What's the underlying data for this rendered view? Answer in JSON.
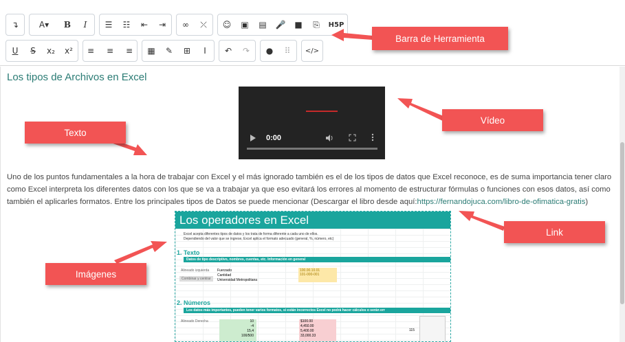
{
  "toolbar": {
    "row1": [
      [
        "paragraph-icon",
        "↴"
      ],
      [
        "font-color-icon",
        "A▾",
        "bold-icon",
        "B",
        "italic-icon",
        "I"
      ],
      [
        "bullet-list-icon",
        "☰",
        "numbered-list-icon",
        "☷",
        "outdent-icon",
        "⇤",
        "indent-icon",
        "⇥"
      ],
      [
        "link-icon",
        "∞",
        "unlink-icon",
        "⤫"
      ],
      [
        "emoji-icon",
        "☺",
        "image-icon",
        "▣",
        "media-icon",
        "▤",
        "record-audio-icon",
        "🎤",
        "record-video-icon",
        "■",
        "copy-icon",
        "⎘",
        "h5p-icon",
        "H5P"
      ]
    ],
    "row2": [
      [
        "underline-icon",
        "U",
        "strikethrough-icon",
        "S",
        "subscript-icon",
        "x₂",
        "superscript-icon",
        "x²"
      ],
      [
        "align-left-icon",
        "≡",
        "align-center-icon",
        "≡",
        "align-right-icon",
        "≡"
      ],
      [
        "calculator-icon",
        "▦",
        "edit-icon",
        "✎",
        "table-icon",
        "⊞",
        "clear-format-icon",
        "Ⅰ"
      ],
      [
        "undo-icon",
        "↶",
        "redo-icon",
        "↷"
      ],
      [
        "accessibility-icon",
        "●",
        "screenreader-icon",
        "⠿"
      ],
      [
        "html-icon",
        "</>"
      ]
    ]
  },
  "editor": {
    "title": "Los tipos de Archivos en Excel",
    "video_time": "0:00",
    "paragraph": "Uno de los puntos fundamentales a la hora de trabajar con Excel y el más ignorado también es el de los tipos de datos que Excel reconoce, es de suma importancia tener claro como Excel interpreta los diferentes datos con los que se va a trabajar ya que eso evitará los errores al momento de estructurar fórmulas o funciones con esos datos, así como también el aplicarles formatos. Entre los principales tipos de Datos se puede mencionar (Descargar el libro desde aquí:",
    "link_text": "https://fernandojuca.com/libro-de-ofimatica-gratis",
    "paragraph_end": ")"
  },
  "sheet": {
    "title": "Los operadores en Excel",
    "intro1": "Excel acepta diferentes tipos de datos y los trata de forma diferente a cada uno de ellos.",
    "intro2": "Dependiendo del valor que se ingrese, Excel aplica el formato adecuado (general, %, número, etc)",
    "s1": "1.  Texto",
    "s1_band": "Datos de tipo descriptivo, nombres, cuentas, etc. Información en general",
    "s1_cells": [
      "Alineado izquierda",
      "Fuerzado",
      "Cantidad",
      "Universidad Metropolitana",
      "Combinar y centrar",
      "100.00.10.01",
      "101-000-001"
    ],
    "s2": "2.  Números",
    "s2_band": "Los datos más importantes, pueden tener varios formatos, si están incorrectos Excel no podrá hacer cálculos o serán err",
    "s2_cells": [
      "Alineado Derecha",
      "10",
      "-4",
      "15,4",
      "100/500",
      "$100.00",
      "4,450.00",
      "5,400.00",
      "33,000.33",
      "115"
    ]
  },
  "callouts": {
    "toolbar": "Barra de Herramienta",
    "video": "Vídeo",
    "text": "Texto",
    "link": "Link",
    "images": "Imágenes"
  },
  "colors": {
    "callout": "#f25454",
    "accent": "#2a7b74",
    "sheet_teal": "#1aa59d"
  }
}
